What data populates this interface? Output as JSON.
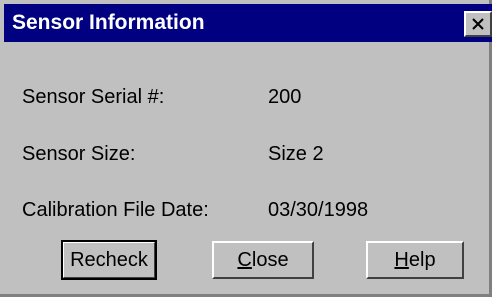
{
  "window": {
    "title": "Sensor Information",
    "close_icon": "close-icon"
  },
  "fields": [
    {
      "label": "Sensor Serial #:",
      "value": "200"
    },
    {
      "label": "Sensor Size:",
      "value": "Size 2"
    },
    {
      "label": "Calibration File Date:",
      "value": "03/30/1998"
    }
  ],
  "buttons": {
    "recheck": {
      "label": "Recheck"
    },
    "close": {
      "mnemonic": "C",
      "rest": "lose"
    },
    "help": {
      "mnemonic": "H",
      "rest": "elp"
    }
  },
  "colors": {
    "titlebar": "#000080",
    "dialog_face": "#c0c0c0"
  }
}
